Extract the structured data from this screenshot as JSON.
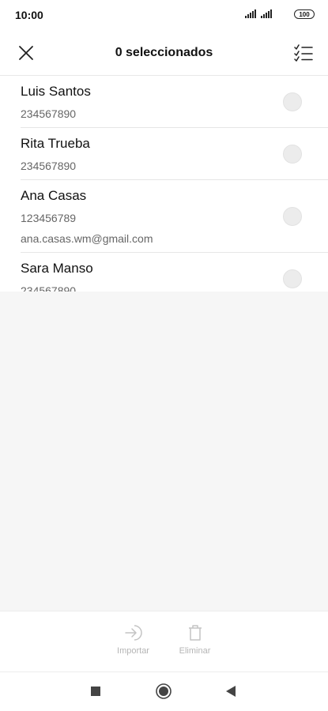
{
  "status_bar": {
    "time": "10:00",
    "battery": "100"
  },
  "header": {
    "title": "0 seleccionados"
  },
  "contacts": [
    {
      "name": "Luis Santos",
      "phone": "234567890",
      "email": ""
    },
    {
      "name": "Rita Trueba",
      "phone": "234567890",
      "email": ""
    },
    {
      "name": "Ana Casas",
      "phone": "123456789",
      "email": "ana.casas.wm@gmail.com"
    },
    {
      "name": "Sara Manso",
      "phone": "234567890",
      "email": ""
    }
  ],
  "actions": {
    "import_label": "Importar",
    "delete_label": "Eliminar"
  },
  "icons": [
    "close-icon",
    "select-all-icon",
    "import-icon",
    "trash-icon",
    "recents-icon",
    "home-icon",
    "back-icon"
  ],
  "colors": {
    "disabled": "#b5b5b5",
    "radio": "#ececec",
    "empty_bg": "#f6f6f6"
  }
}
